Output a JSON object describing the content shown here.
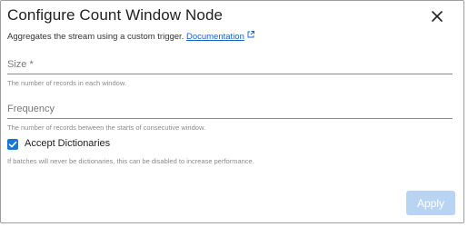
{
  "dialog": {
    "title": "Configure Count Window Node",
    "description": "Aggregates the stream using a custom trigger.",
    "doc_link": "Documentation"
  },
  "fields": {
    "size": {
      "label": "Size *",
      "value": "",
      "hint": "The number of records in each window."
    },
    "frequency": {
      "label": "Frequency",
      "value": "",
      "hint": "The number of records between the starts of consecutive window."
    }
  },
  "accept_dictionaries": {
    "label": "Accept Dictionaries",
    "checked": true,
    "hint": "If batches will never be dictionaries, this can be disabled to increase performance."
  },
  "actions": {
    "apply_label": "Apply",
    "apply_disabled": true
  },
  "icons": {
    "close": "close-icon",
    "external_link": "external-link-icon",
    "check": "check-icon"
  },
  "colors": {
    "accent": "#1976d2",
    "link": "#1565c0",
    "apply_disabled": "#b9d4f2"
  }
}
